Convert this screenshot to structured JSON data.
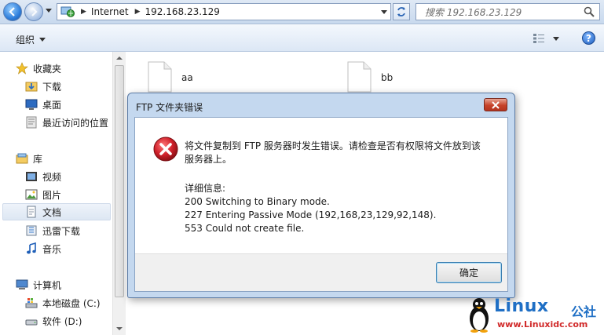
{
  "address_bar": {
    "crumbs": [
      "Internet",
      "192.168.23.129"
    ],
    "search_placeholder": "搜索 192.168.23.129"
  },
  "toolbar": {
    "organize_label": "组织"
  },
  "nav_pane": {
    "favorites": {
      "label": "收藏夹",
      "items": [
        "下载",
        "桌面",
        "最近访问的位置"
      ]
    },
    "libraries": {
      "label": "库",
      "items": [
        "视频",
        "图片",
        "文档",
        "迅雷下载",
        "音乐"
      ],
      "selected": "文档"
    },
    "computer": {
      "label": "计算机",
      "items": [
        "本地磁盘 (C:)",
        "软件 (D:)"
      ]
    }
  },
  "files": [
    {
      "name": "aa"
    },
    {
      "name": "bb"
    }
  ],
  "dialog": {
    "title": "FTP 文件夹错误",
    "message_line1": "将文件复制到 FTP 服务器时发生错误。请检查是否有权限将文件放到该",
    "message_line2": "服务器上。",
    "details_label": "详细信息:",
    "details": [
      "200 Switching to Binary mode.",
      "227 Entering Passive Mode (192,168,23,129,92,148).",
      "553 Could not create file."
    ],
    "ok_label": "确定"
  },
  "watermark": {
    "logo": "Linux",
    "cn": "公社",
    "url": "www.Linuxidc.com"
  },
  "colors": {
    "accent": "#1f6fc5",
    "error_red": "#c8232c",
    "dialog_frame": "#c4d8ef"
  }
}
